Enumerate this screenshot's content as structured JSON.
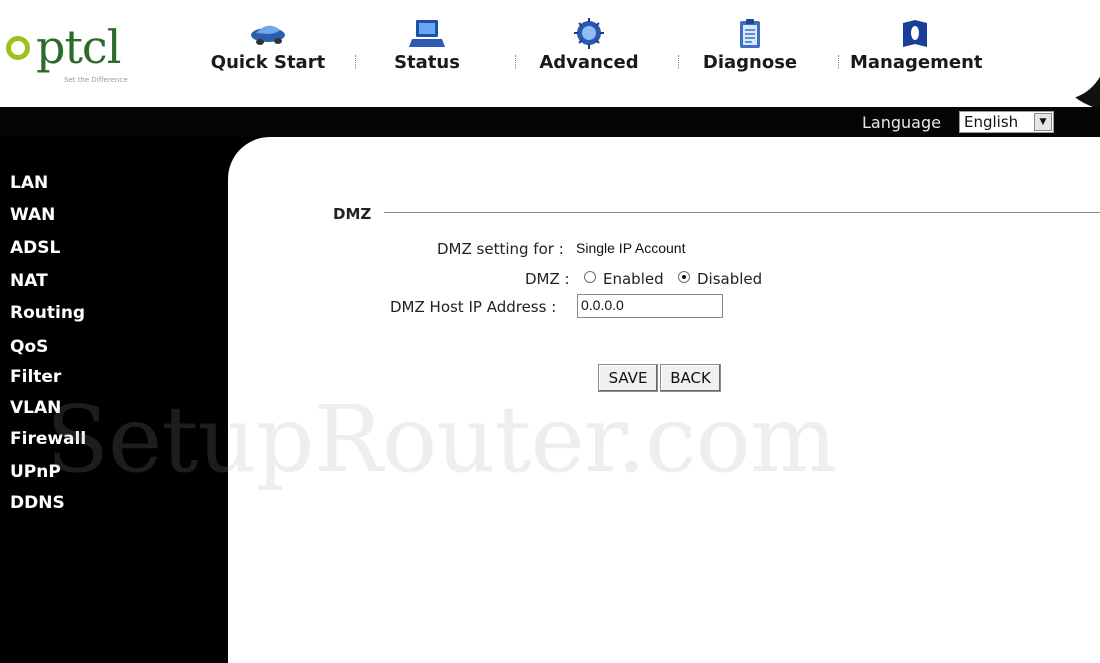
{
  "brand": {
    "logo_text": "ptcl",
    "tagline": "Set the Difference",
    "colors": {
      "ring": "#9bc21f",
      "text": "#2d6b2d"
    }
  },
  "topnav": {
    "items": [
      {
        "label": "Quick Start",
        "icon": "car-icon"
      },
      {
        "label": "Status",
        "icon": "laptop-icon"
      },
      {
        "label": "Advanced",
        "icon": "chip-icon"
      },
      {
        "label": "Diagnose",
        "icon": "clipboard-icon"
      },
      {
        "label": "Management",
        "icon": "book-icon"
      }
    ]
  },
  "language": {
    "label": "Language",
    "selected": "English"
  },
  "sidebar": {
    "items": [
      {
        "label": "LAN"
      },
      {
        "label": "WAN"
      },
      {
        "label": "ADSL"
      },
      {
        "label": "NAT"
      },
      {
        "label": "Routing"
      },
      {
        "label": "QoS"
      },
      {
        "label": "Filter"
      },
      {
        "label": "VLAN"
      },
      {
        "label": "Firewall"
      },
      {
        "label": "UPnP"
      },
      {
        "label": "DDNS"
      }
    ]
  },
  "dmz": {
    "section_title": "DMZ",
    "setting_for_label": "DMZ setting for :",
    "setting_for_value": "Single IP Account",
    "dmz_label": "DMZ :",
    "enabled_label": "Enabled",
    "disabled_label": "Disabled",
    "selected": "Disabled",
    "host_ip_label": "DMZ Host IP Address :",
    "host_ip_value": "0.0.0.0"
  },
  "buttons": {
    "save": "SAVE",
    "back": "BACK"
  },
  "watermark": "SetupRouter.com"
}
